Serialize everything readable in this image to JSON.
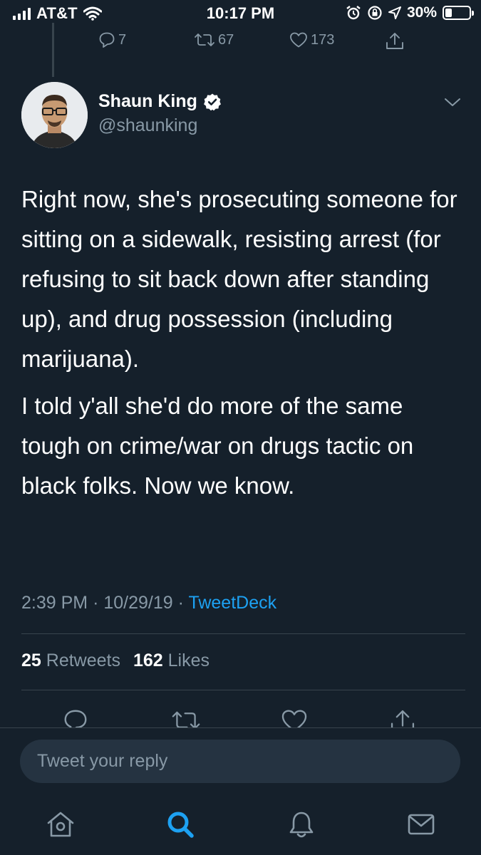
{
  "status_bar": {
    "carrier": "AT&T",
    "time": "10:17 PM",
    "battery": "30%",
    "icons": [
      "signal-icon",
      "wifi-icon",
      "alarm-icon",
      "rotation-lock-icon",
      "location-icon",
      "battery-icon"
    ]
  },
  "parent_tweet": {
    "replies": "7",
    "retweets": "67",
    "likes": "173"
  },
  "tweet": {
    "author_name": "Shaun King",
    "handle": "@shaunking",
    "paragraphs": [
      "Right now, she's prosecuting someone for sitting on a sidewalk, resisting arrest (for refusing to sit back down after standing up), and drug possession (including marijuana).",
      "I told y'all she'd do more of the same tough on crime/war on drugs tactic on black folks. Now we know."
    ],
    "time": "2:39 PM",
    "separator": "·",
    "date": "10/29/19",
    "source": "TweetDeck"
  },
  "engagement": {
    "retweets_count": "25",
    "retweets_label": "Retweets",
    "likes_count": "162",
    "likes_label": "Likes"
  },
  "reply": {
    "placeholder": "Tweet your reply"
  },
  "tabbar": {
    "items": [
      "home-icon",
      "search-icon",
      "notifications-icon",
      "messages-icon"
    ],
    "active": "search-icon"
  },
  "colors": {
    "background": "#15202b",
    "secondary_text": "#8899a6",
    "accent": "#1da1f2",
    "divider": "#38444d",
    "input_background": "#253341"
  }
}
